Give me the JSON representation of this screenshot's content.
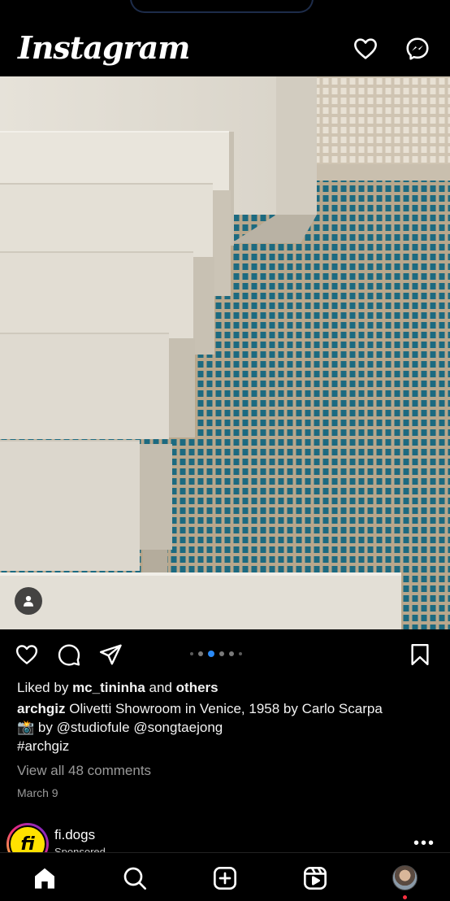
{
  "header": {
    "logo": "Instagram",
    "icons": [
      "heart-icon",
      "messenger-icon"
    ]
  },
  "post": {
    "carousel": {
      "count": 6,
      "active_index": 2
    },
    "liked_by_prefix": "Liked by",
    "liked_by_user": "mc_tininha",
    "liked_by_and": "and",
    "liked_by_others": "others",
    "caption_user": "archgiz",
    "caption_text": "Olivetti Showroom in Venice, 1958 by Carlo Scarpa",
    "caption_line2_emoji": "📸",
    "caption_line2": "by @studiofule @songtaejong",
    "caption_line3": "#archgiz",
    "view_comments": "View all 48 comments",
    "date": "March 9"
  },
  "next_post": {
    "avatar_text": "fi",
    "username": "fi.dogs",
    "subtitle": "Sponsored",
    "more": "•••"
  },
  "bottom_nav": [
    "home-icon",
    "search-icon",
    "create-icon",
    "reels-icon",
    "profile-avatar"
  ],
  "colors": {
    "accent": "#2a8af6",
    "background": "#000000",
    "notification": "#ff3040"
  }
}
